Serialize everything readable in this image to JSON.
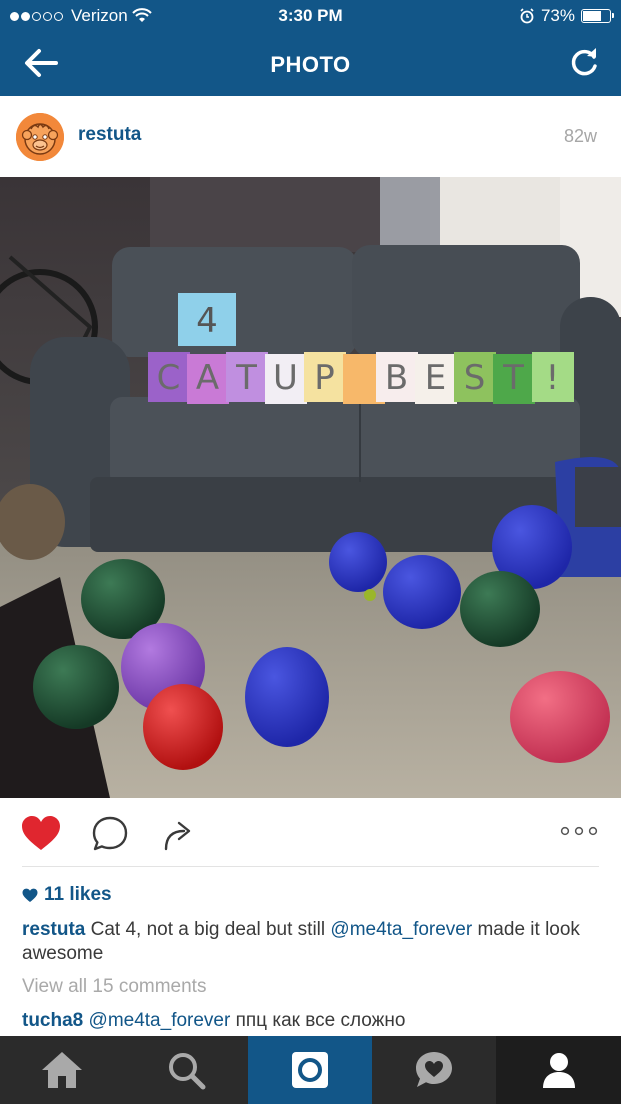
{
  "status_bar": {
    "carrier": "Verizon",
    "time": "3:30 PM",
    "battery": "73%",
    "battery_level": 0.73,
    "signal_bars_filled": 2,
    "signal_bars_total": 5
  },
  "nav": {
    "title": "PHOTO",
    "back_icon": "arrow-left-icon",
    "refresh_icon": "refresh-icon"
  },
  "post": {
    "username": "restuta",
    "age": "82w",
    "photo_alt_icon": "photo"
  },
  "actions": {
    "like_icon": "heart-icon",
    "comment_icon": "comment-icon",
    "share_icon": "share-icon",
    "more_icon": "more-icon"
  },
  "likes": {
    "text": "11 likes"
  },
  "caption": {
    "username": "restuta",
    "text_before": " Cat 4, not a big deal but still ",
    "mention": "@me4ta_forever",
    "text_after": " made it look awesome"
  },
  "view_all": "View all 15 comments",
  "comments": [
    {
      "username": "tucha8",
      "mention": "@me4ta_forever",
      "text": " ппц как все сложно"
    }
  ],
  "sign": {
    "top": "4",
    "letters": [
      "C",
      "A",
      "T",
      "U",
      "P",
      "",
      "B",
      "E",
      "S",
      "T",
      "!"
    ]
  },
  "colors": {
    "brand_blue": "#125688",
    "like_red": "#e0262f",
    "tabbar_dark": "#2b2b2b"
  },
  "tabbar": [
    {
      "name": "home",
      "icon": "home-icon"
    },
    {
      "name": "explore",
      "icon": "search-icon"
    },
    {
      "name": "camera",
      "icon": "camera-icon",
      "active": true
    },
    {
      "name": "activity",
      "icon": "heart-bubble-icon"
    },
    {
      "name": "profile",
      "icon": "person-icon"
    }
  ]
}
